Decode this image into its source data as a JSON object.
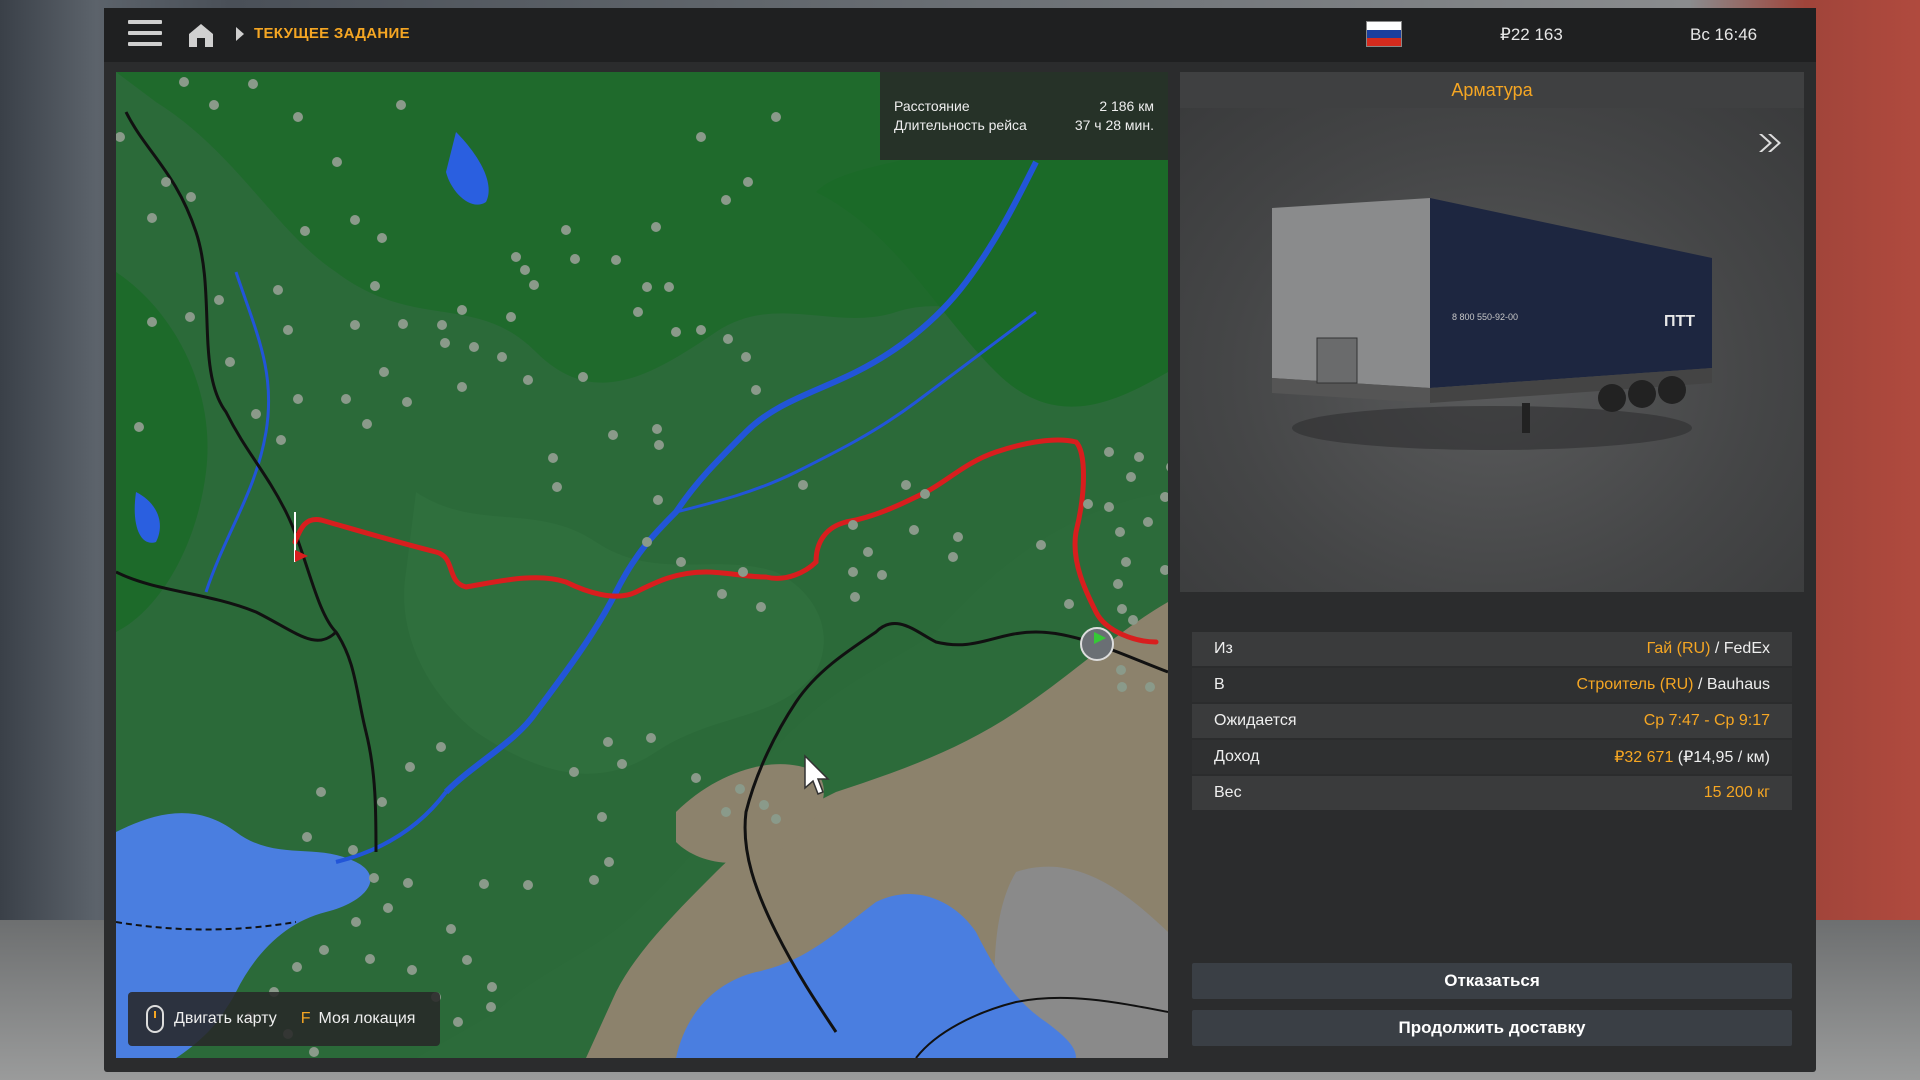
{
  "topbar": {
    "breadcrumb": "ТЕКУЩЕЕ ЗАДАНИЕ",
    "money": "₽22 163",
    "clock": "Вс 16:46",
    "flag_colors": [
      "#ffffff",
      "#1c3f9e",
      "#d52b1e"
    ]
  },
  "route": {
    "distance_label": "Расстояние",
    "distance_value": "2 186 км",
    "duration_label": "Длительность рейса",
    "duration_value": "37 ч 28 мин."
  },
  "map_controls": {
    "move_label": "Двигать карту",
    "key": "F",
    "location_label": "Моя локация"
  },
  "cargo": {
    "title": "Арматура",
    "trailer_phone": "8 800 550-92-00",
    "trailer_logo": "ПТТ"
  },
  "details": {
    "from_label": "Из",
    "from_city": "Гай (RU)",
    "from_company": " / FedEx",
    "to_label": "В",
    "to_city": "Строитель (RU)",
    "to_company": " / Bauhaus",
    "expected_label": "Ожидается",
    "expected_value": "Ср 7:47 - Ср 9:17",
    "income_label": "Доход",
    "income_value": "₽32 671",
    "income_rate": " (₽14,95 / км)",
    "weight_label": "Вес",
    "weight_value": "15 200 кг"
  },
  "buttons": {
    "decline": "Отказаться",
    "continue": "Продолжить доставку"
  },
  "colors": {
    "accent": "#f5a623",
    "route": "#d81e1e"
  }
}
